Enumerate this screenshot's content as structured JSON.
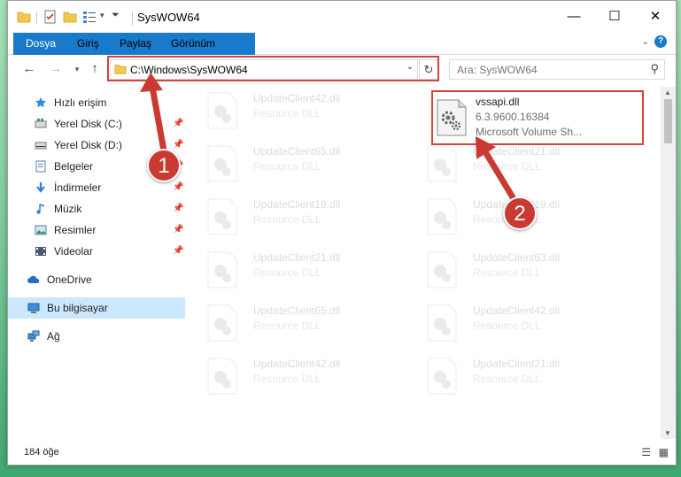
{
  "window": {
    "title": "SysWOW64",
    "controls": [
      "—",
      "☐",
      "✕"
    ]
  },
  "ribbon": {
    "tabs": [
      "Dosya",
      "Giriş",
      "Paylaş",
      "Görünüm"
    ]
  },
  "address": {
    "path": "C:\\Windows\\SysWOW64",
    "search_placeholder": "Ara: SysWOW64"
  },
  "sidebar": {
    "items": [
      {
        "label": "Hızlı erişim",
        "icon": "star-icon",
        "pinned": false
      },
      {
        "label": "Yerel Disk (C:)",
        "icon": "drive-icon",
        "pinned": true
      },
      {
        "label": "Yerel Disk (D:)",
        "icon": "drive-icon",
        "pinned": true
      },
      {
        "label": "Belgeler",
        "icon": "documents-icon",
        "pinned": true
      },
      {
        "label": "İndirmeler",
        "icon": "download-icon",
        "pinned": true
      },
      {
        "label": "Müzik",
        "icon": "music-icon",
        "pinned": true
      },
      {
        "label": "Resimler",
        "icon": "pictures-icon",
        "pinned": true
      },
      {
        "label": "Videolar",
        "icon": "videos-icon",
        "pinned": true
      },
      {
        "label": "OneDrive",
        "icon": "cloud-icon",
        "pinned": false
      },
      {
        "label": "Bu bilgisayar",
        "icon": "computer-icon",
        "pinned": false,
        "selected": true
      },
      {
        "label": "Ağ",
        "icon": "network-icon",
        "pinned": false
      }
    ]
  },
  "files": {
    "selected": {
      "name": "vssapi.dll",
      "version": "6.3.9600.16384",
      "description": "Microsoft Volume Sh..."
    },
    "left_column": [
      {
        "name": "UpdateClient42.dll",
        "type": "Resource DLL"
      },
      {
        "name": "UpdateClient65.dll",
        "type": "Resource DLL"
      },
      {
        "name": "UpdateClient19.dll",
        "type": "Resource DLL"
      },
      {
        "name": "UpdateClient21.dll",
        "type": "Resource DLL"
      },
      {
        "name": "UpdateClient65.dll",
        "type": "Resource DLL"
      },
      {
        "name": "UpdateClient42.dll",
        "type": "Resource DLL"
      }
    ],
    "right_column": [
      {
        "name": "UpdateClient21.dll",
        "type": "Resource DLL"
      },
      {
        "name": "UpdateClient19.dll",
        "type": "Resource DLL"
      },
      {
        "name": "UpdateClient63.dll",
        "type": "Resource DLL"
      },
      {
        "name": "UpdateClient42.dll",
        "type": "Resource DLL"
      },
      {
        "name": "UpdateClient21.dll",
        "type": "Resource DLL"
      }
    ]
  },
  "status": {
    "item_count": "184 öğe"
  },
  "annotations": {
    "step1": "1",
    "step2": "2",
    "color": "#d0453c"
  }
}
